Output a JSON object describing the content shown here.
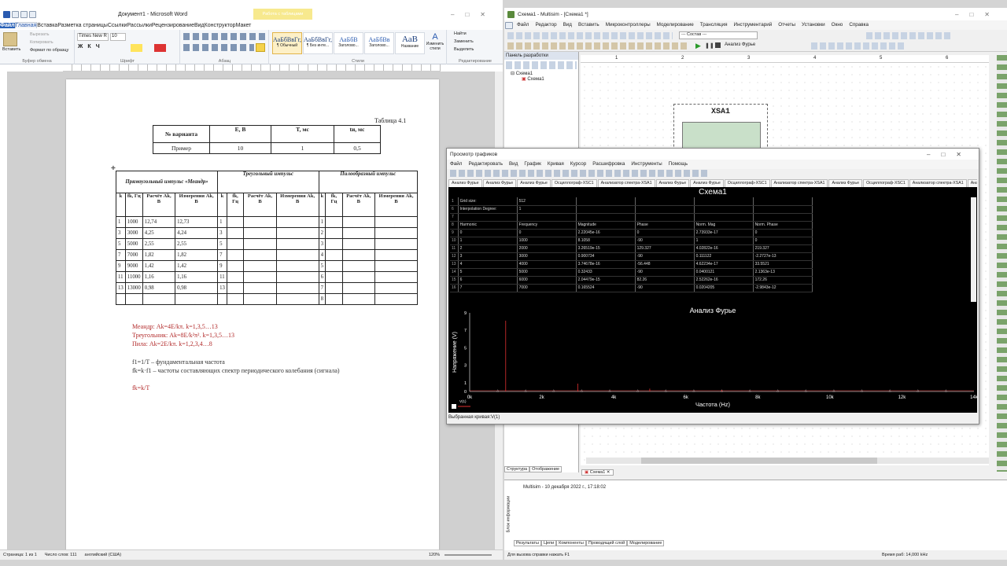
{
  "word": {
    "title": "Документ1 - Microsoft Word",
    "ctx_tab": "Работа с таблицами",
    "tabs": [
      "Файл",
      "Главная",
      "Вставка",
      "Разметка страницы",
      "Ссылки",
      "Рассылки",
      "Рецензирование",
      "Вид",
      "Конструктор",
      "Макет"
    ],
    "ribbon": {
      "paste": "Вставить",
      "clip_items": [
        "Вырезать",
        "Копировать",
        "Формат по образцу"
      ],
      "font_name": "Times New R",
      "font_size": "10",
      "groups": [
        "Буфер обмена",
        "Шрифт",
        "Абзац",
        "Стили",
        "Редактирование"
      ],
      "styles": [
        {
          "sample": "АаБбВвГг,",
          "name": "¶ Обычный"
        },
        {
          "sample": "АаБбВвГг,",
          "name": "¶ Без инте..."
        },
        {
          "sample": "АаБбВ",
          "name": "Заголово..."
        },
        {
          "sample": "АаБбВв",
          "name": "Заголово..."
        },
        {
          "sample": "АаВ",
          "name": "Название"
        }
      ],
      "change_styles": "Изменить стили",
      "edit_items": [
        "Найти",
        "Заменить",
        "Выделить"
      ]
    },
    "caption": "Таблица 4.1",
    "table1": {
      "headers": [
        "№ варианта",
        "E, В",
        "T, мс",
        "tи, мс"
      ],
      "row": [
        "Пример",
        "10",
        "1",
        "0,5"
      ]
    },
    "table2": {
      "groups": [
        "Прямоугольный импульс «Меандр»",
        "Треугольный импульс",
        "Пилообразный импульс"
      ],
      "subheaders": [
        "k",
        "fk, Гц",
        "Расчёт Ak, В",
        "Измерения Ak, В",
        "k",
        "fk, Гц",
        "Расчёт Ak, В",
        "Измерения Ak, В",
        "k",
        "fk, Гц",
        "Расчёт Ak, В",
        "Измерения Ak, В"
      ],
      "rows": [
        [
          "1",
          "1000",
          "12,74",
          "12,73",
          "1",
          "",
          "",
          "",
          "1",
          "",
          "",
          ""
        ],
        [
          "3",
          "3000",
          "4,25",
          "4,24",
          "3",
          "",
          "",
          "",
          "2",
          "",
          "",
          ""
        ],
        [
          "5",
          "5000",
          "2,55",
          "2,55",
          "5",
          "",
          "",
          "",
          "3",
          "",
          "",
          ""
        ],
        [
          "7",
          "7000",
          "1,82",
          "1,82",
          "7",
          "",
          "",
          "",
          "4",
          "",
          "",
          ""
        ],
        [
          "9",
          "9000",
          "1,42",
          "1,42",
          "9",
          "",
          "",
          "",
          "5",
          "",
          "",
          ""
        ],
        [
          "11",
          "11000",
          "1,16",
          "1,16",
          "11",
          "",
          "",
          "",
          "6",
          "",
          "",
          ""
        ],
        [
          "13",
          "13000",
          "0,98",
          "0,98",
          "13",
          "",
          "",
          "",
          "7",
          "",
          "",
          ""
        ],
        [
          "",
          "",
          "",
          "",
          "",
          "",
          "",
          "",
          "8",
          "",
          "",
          ""
        ]
      ]
    },
    "formulas": [
      "Меандр: Ak=4E/kπ.      k=1,3,5…13",
      "Треугольник: Ak=8E/k²π².       k=1,3,5…13",
      "Пила: Ak=2E/kπ.           k=1,2,3,4…8",
      "f1=1/T – фундаментальная частота",
      "fk=k·f1 – частоты составляющих спектр периодического колебания (сигнала)",
      "fk=k/T"
    ],
    "status": [
      "Страница: 1 из 1",
      "Число слов: 111",
      "английский (США)",
      "120%"
    ]
  },
  "multisim": {
    "title": "Схема1 - Multisim - [Схема1 *]",
    "menu": [
      "Файл",
      "Редактор",
      "Вид",
      "Вставить",
      "Микроконтроллеры",
      "Моделирование",
      "Трансляция",
      "Инструментарий",
      "Отчеты",
      "Установки",
      "Окно",
      "Справка"
    ],
    "combo": "--- Состав ---",
    "analysis_btn": "Анализ Фурье",
    "panel_title": "Панель разработки",
    "tree": [
      "Схема1",
      "Схема1"
    ],
    "ruler": [
      "1",
      "2",
      "3",
      "4",
      "5",
      "6"
    ],
    "instrument": "XSA1",
    "bottom_tabs": [
      "Структура",
      "Отображение"
    ],
    "sheet_tab": "Схема1",
    "log": "Multisim  -  10 декабря 2022 г., 17:18:02",
    "info_vtab": "Блок информации",
    "info_tabs": [
      "Результаты",
      "Цепи",
      "Компоненты",
      "Проводящий слой",
      "Моделирование"
    ],
    "status_left": "Для вызова справки нажать F1",
    "status_right": "Время раб: 14,000 kHz"
  },
  "grapher": {
    "title": "Просмотр графиков",
    "menu": [
      "Файл",
      "Редактировать",
      "Вид",
      "График",
      "Кривая",
      "Курсор",
      "Расшифровка",
      "Инструменты",
      "Помощь"
    ],
    "tabs": [
      "Анализ Фурье",
      "Анализ Фурье",
      "Анализ Фурье",
      "Осциллограф-XSC1",
      "Анализатор спектра-XSA1",
      "Анализ Фурье",
      "Анализ Фурье",
      "Осциллограф-XSC1",
      "Анализатор спектра-XSA1",
      "Анализ Фурье",
      "Осциллограф-XSC1",
      "Анализатор спектра-XSA1",
      "Анализ Ф"
    ],
    "circuit": "Схема1",
    "info": [
      [
        "Grid size:",
        "512"
      ],
      [
        "Interpolation Degree:",
        "1"
      ]
    ],
    "row_nums": [
      "1",
      "6",
      "7",
      "8",
      "9",
      "10",
      "11",
      "12",
      "13",
      "14",
      "15",
      "16"
    ],
    "header": [
      "Harmonic",
      "Frequency",
      "Magnitude",
      "Phase",
      "Norm. Mag",
      "Norm. Phase"
    ],
    "rows": [
      [
        "0",
        "0",
        "2.22045e-16",
        "0",
        "2.73933e-17",
        "0"
      ],
      [
        "1",
        "1000",
        "8.1058",
        "-90",
        "1",
        "0"
      ],
      [
        "2",
        "2000",
        "3.26519e-15",
        "129.327",
        "4.02822e-16",
        "219.327"
      ],
      [
        "3",
        "3000",
        "0.900734",
        "-90",
        "0.111122",
        "-2.2727e-13"
      ],
      [
        "4",
        "4000",
        "3.74678e-16",
        "-56.448",
        "4.62234e-17",
        "33.5521"
      ],
      [
        "5",
        "5000",
        "0.32433",
        "-90",
        "0.0400121",
        "2.1363e-13"
      ],
      [
        "6",
        "6000",
        "2.04479e-15",
        "82.26",
        "2.52262e-16",
        "172.26"
      ],
      [
        "7",
        "7000",
        "0.165524",
        "-90",
        "0.0204205",
        "-2.9843e-12"
      ]
    ],
    "status": "Выбранная кривая:V(1)",
    "legend": "V(1)"
  },
  "chart_data": {
    "type": "bar",
    "title": "Анализ Фурье",
    "xlabel": "Частота (Hz)",
    "ylabel": "Напряжение (V)",
    "x_ticks": [
      "0k",
      "2k",
      "4k",
      "6k",
      "8k",
      "10k",
      "12k",
      "14k"
    ],
    "y_ticks": [
      "0",
      "1",
      "3",
      "5",
      "7",
      "9"
    ],
    "xlim": [
      0,
      14000
    ],
    "ylim": [
      0,
      9
    ],
    "series": [
      {
        "name": "V(1)",
        "x": [
          0,
          1000,
          2000,
          3000,
          4000,
          5000,
          6000,
          7000
        ],
        "values": [
          0,
          8.1058,
          0,
          0.900734,
          0,
          0.32433,
          0,
          0.165524
        ]
      }
    ],
    "colors": {
      "series": "#e03030",
      "background": "#000000",
      "axis": "#ffffff"
    }
  }
}
